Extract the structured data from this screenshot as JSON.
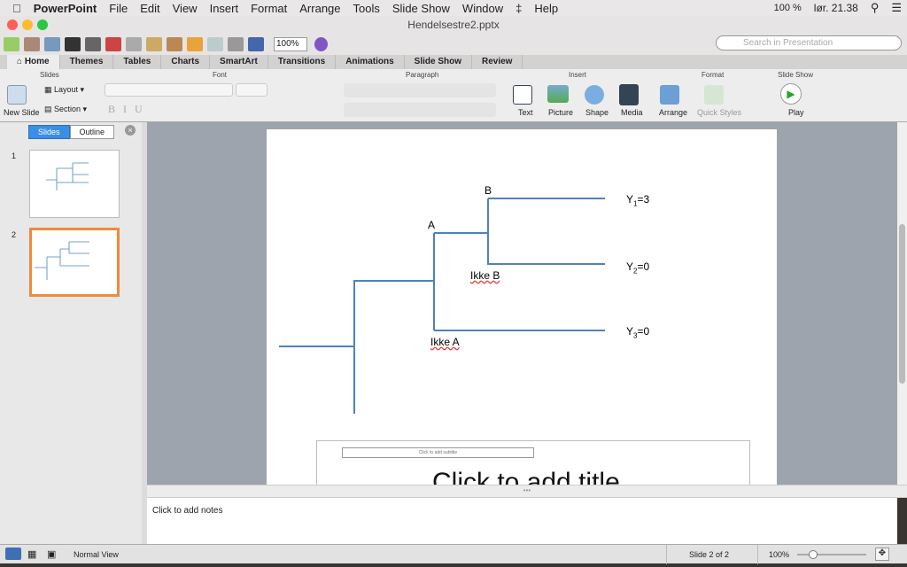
{
  "menubar": {
    "app": "PowerPoint",
    "items": [
      "File",
      "Edit",
      "View",
      "Insert",
      "Format",
      "Arrange",
      "Tools",
      "Slide Show",
      "Window",
      "Help"
    ],
    "battery": "100 %",
    "clock": "lør. 21.38"
  },
  "window": {
    "title": "Hendelsestre2.pptx"
  },
  "toolbar": {
    "zoom": "100%",
    "search_placeholder": "Search in Presentation"
  },
  "tabs": [
    "Home",
    "Themes",
    "Tables",
    "Charts",
    "SmartArt",
    "Transitions",
    "Animations",
    "Slide Show",
    "Review"
  ],
  "ribbon": {
    "groups": [
      "Slides",
      "Font",
      "Paragraph",
      "Insert",
      "Format",
      "Slide Show"
    ],
    "new_slide": "New Slide",
    "layout": "Layout",
    "section": "Section",
    "text": "Text",
    "picture": "Picture",
    "shape": "Shape",
    "media": "Media",
    "arrange": "Arrange",
    "quick_styles": "Quick Styles",
    "play": "Play"
  },
  "panel": {
    "slides_tab": "Slides",
    "outline_tab": "Outline",
    "thumbs": [
      "1",
      "2"
    ]
  },
  "slide": {
    "labels": {
      "b": "B",
      "a": "A",
      "not_b": "Ikke B",
      "not_a": "Ikke A"
    },
    "outcomes": [
      {
        "y": "Y",
        "sub": "1",
        "val": "=3"
      },
      {
        "y": "Y",
        "sub": "2",
        "val": "=0"
      },
      {
        "y": "Y",
        "sub": "3",
        "val": "=0"
      }
    ],
    "subtitle_placeholder": "Click to add subtitle",
    "title_placeholder": "Click to add title",
    "line_color": "#4f81bd"
  },
  "notes": {
    "placeholder": "Click to add notes"
  },
  "status": {
    "view": "Normal View",
    "slide": "Slide 2 of 2",
    "zoom": "100%"
  }
}
